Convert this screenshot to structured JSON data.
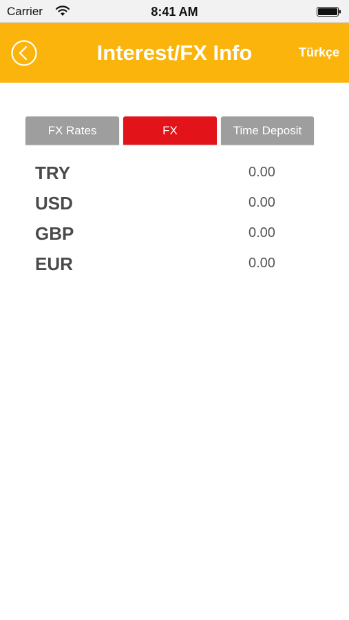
{
  "status_bar": {
    "carrier": "Carrier",
    "time": "8:41 AM",
    "wifi_icon": "wifi-icon",
    "battery_icon": "battery-icon"
  },
  "header": {
    "title": "Interest/FX Info",
    "language_label": "Türkçe",
    "back_icon": "back-chevron-circle-icon",
    "background_color": "#fbb40c"
  },
  "tabs": [
    {
      "label": "FX Rates",
      "active": false
    },
    {
      "label": "FX",
      "active": true
    },
    {
      "label": "Time Deposit",
      "active": false
    }
  ],
  "colors": {
    "tab_active": "#e2141a",
    "tab_inactive": "#9e9e9e"
  },
  "rates": [
    {
      "currency": "TRY",
      "value": "0.00"
    },
    {
      "currency": "USD",
      "value": "0.00"
    },
    {
      "currency": "GBP",
      "value": "0.00"
    },
    {
      "currency": "EUR",
      "value": "0.00"
    }
  ]
}
